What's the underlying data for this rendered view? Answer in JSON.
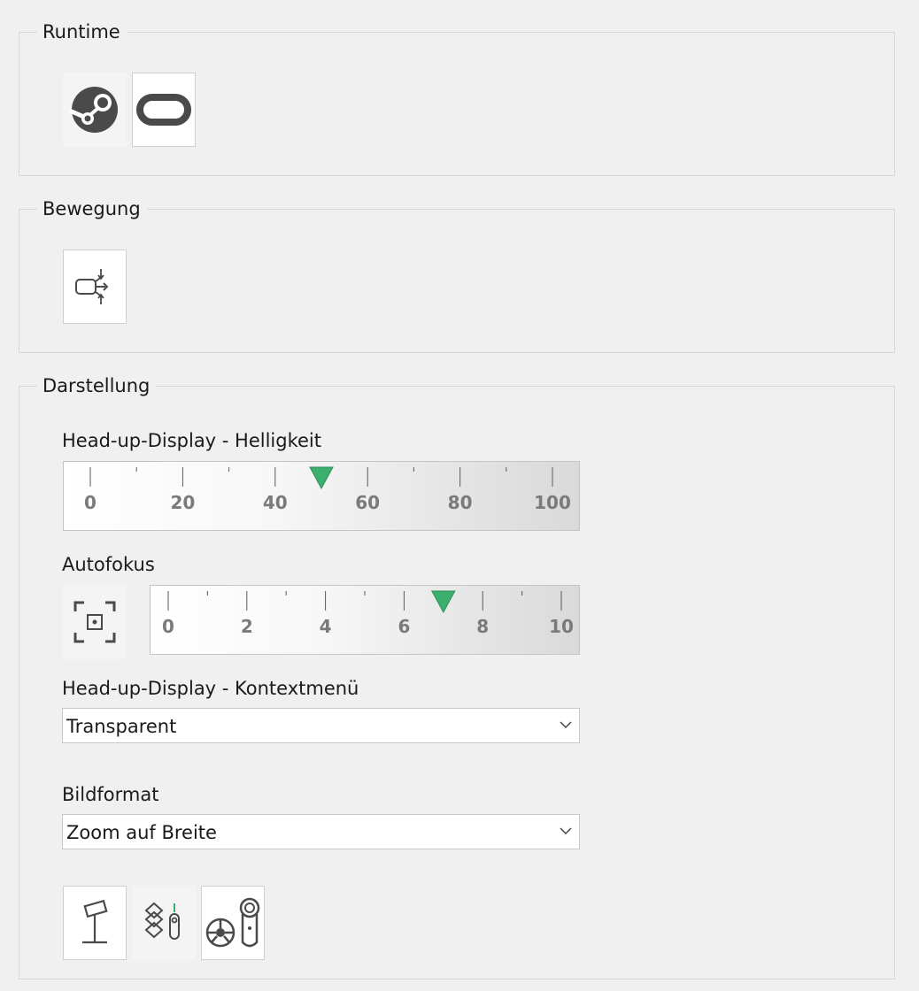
{
  "runtime": {
    "title": "Runtime",
    "buttons": [
      {
        "icon": "steam-icon",
        "selected": false
      },
      {
        "icon": "oculus-icon",
        "selected": true
      }
    ]
  },
  "movement": {
    "title": "Bewegung",
    "buttons": [
      {
        "icon": "motion-compensation-icon",
        "selected": true
      }
    ]
  },
  "display": {
    "title": "Darstellung",
    "hud_brightness": {
      "label": "Head-up-Display - Helligkeit",
      "min": 0,
      "max": 100,
      "value": 50,
      "tick_labels": [
        "0",
        "20",
        "40",
        "60",
        "80",
        "100"
      ]
    },
    "autofocus": {
      "label": "Autofokus",
      "min": 0,
      "max": 10,
      "value": 7,
      "tick_labels": [
        "0",
        "2",
        "4",
        "6",
        "8",
        "10"
      ]
    },
    "hud_context_menu": {
      "label": "Head-up-Display - Kontextmenü",
      "value": "Transparent"
    },
    "aspect": {
      "label": "Bildformat",
      "value": "Zoom auf Breite"
    },
    "bottom_buttons": [
      {
        "icon": "cockpit-stand-icon",
        "selected": true
      },
      {
        "icon": "layers-controller-icon",
        "selected": false
      },
      {
        "icon": "wheel-controller-icon",
        "selected": true
      }
    ]
  },
  "colors": {
    "accent": "#3cae6e",
    "border": "#d8d8d8",
    "icon": "#4a4a4a"
  }
}
